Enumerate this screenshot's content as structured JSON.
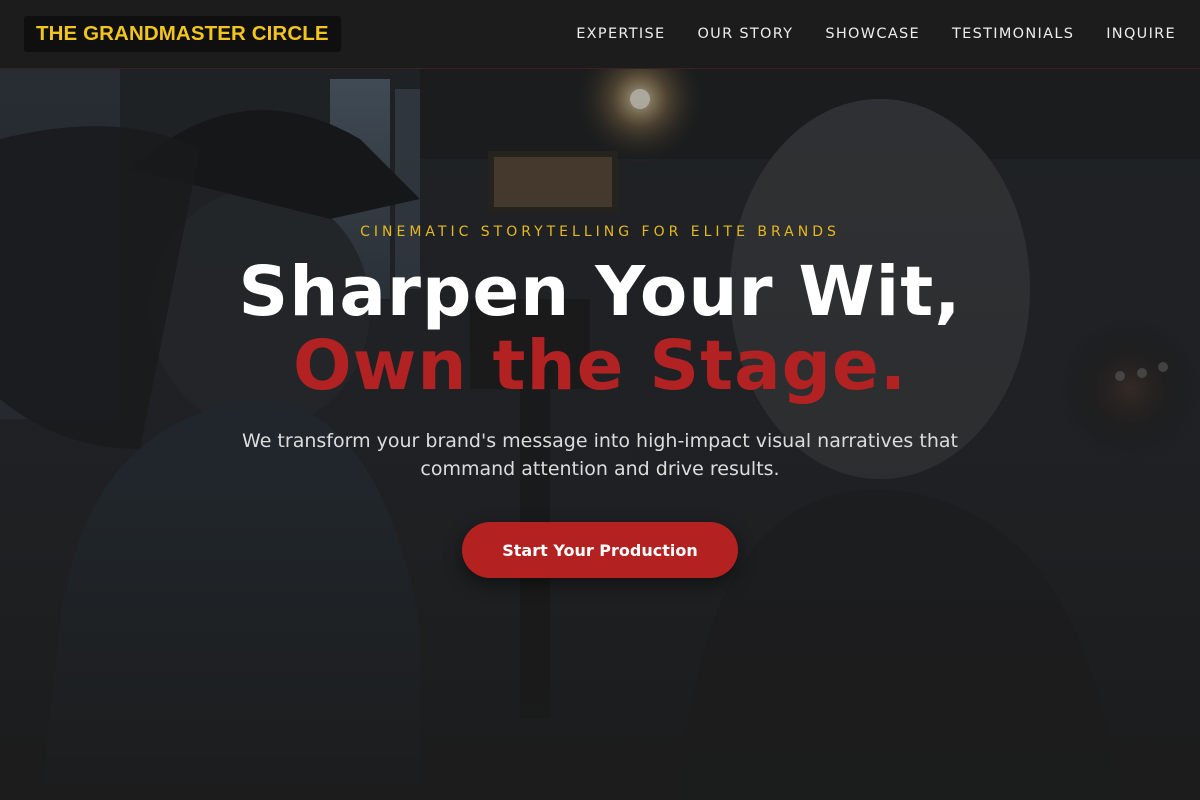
{
  "brand": {
    "name": "THE GRANDMASTER CIRCLE"
  },
  "nav": {
    "items": [
      {
        "label": "EXPERTISE"
      },
      {
        "label": "OUR STORY"
      },
      {
        "label": "SHOWCASE"
      },
      {
        "label": "TESTIMONIALS"
      },
      {
        "label": "INQUIRE"
      }
    ]
  },
  "hero": {
    "eyebrow": "CINEMATIC STORYTELLING FOR ELITE BRANDS",
    "headline_line1": "Sharpen Your Wit,",
    "headline_line2": "Own the Stage.",
    "subtitle": "We transform your brand's message into high-impact visual narratives that command attention and drive results.",
    "cta_label": "Start Your Production"
  },
  "colors": {
    "accent_gold": "#f2c41f",
    "accent_red": "#b22222",
    "background": "#1b1b1b"
  }
}
